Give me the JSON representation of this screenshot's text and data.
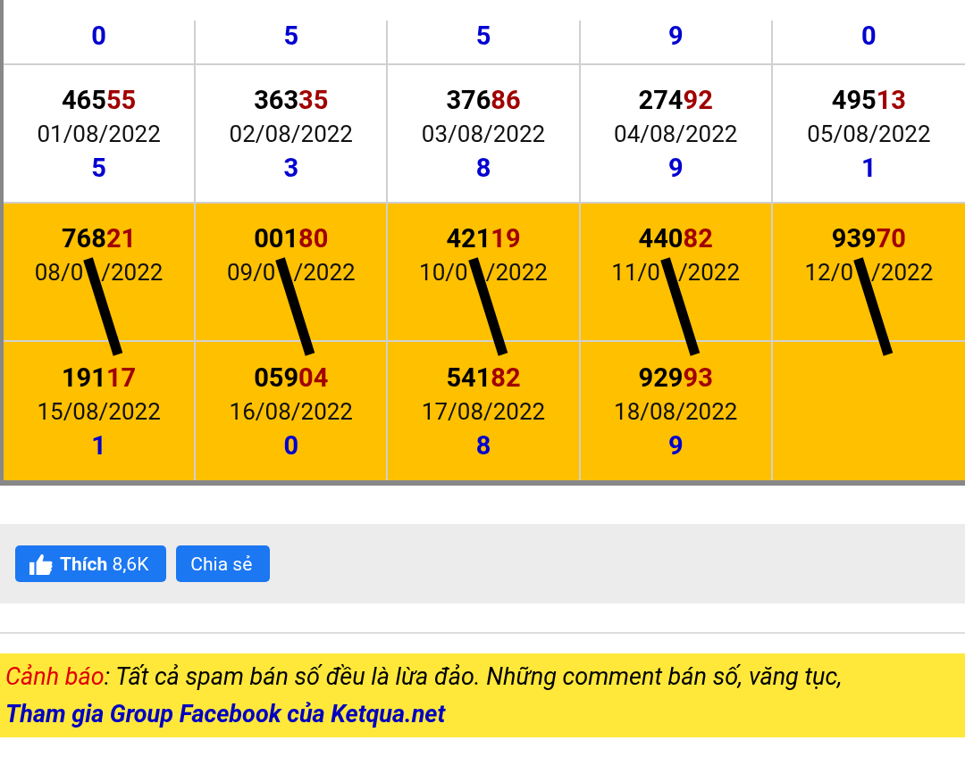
{
  "results": {
    "rows": [
      {
        "cells": [
          {
            "digit": "0"
          },
          {
            "digit": "5"
          },
          {
            "digit": "5"
          },
          {
            "digit": "9"
          },
          {
            "digit": "0"
          }
        ]
      },
      {
        "highlighted": false,
        "cells": [
          {
            "head": "465",
            "tail": "55",
            "date": "01/08/2022",
            "digit": "5",
            "crossed": false
          },
          {
            "head": "363",
            "tail": "35",
            "date": "02/08/2022",
            "digit": "3",
            "crossed": false
          },
          {
            "head": "376",
            "tail": "86",
            "date": "03/08/2022",
            "digit": "8",
            "crossed": false
          },
          {
            "head": "274",
            "tail": "92",
            "date": "04/08/2022",
            "digit": "9",
            "crossed": false
          },
          {
            "head": "495",
            "tail": "13",
            "date": "05/08/2022",
            "digit": "1",
            "crossed": false
          }
        ]
      },
      {
        "highlighted": true,
        "cells": [
          {
            "head": "768",
            "tail": "21",
            "date_start": "08/0",
            "date_end": "/2022",
            "crossed": true
          },
          {
            "head": "001",
            "tail": "80",
            "date_start": "09/0",
            "date_end": "/2022",
            "crossed": true
          },
          {
            "head": "421",
            "tail": "19",
            "date_start": "10/0",
            "date_end": "/2022",
            "crossed": true
          },
          {
            "head": "440",
            "tail": "82",
            "date_start": "11/0",
            "date_end": "/2022",
            "crossed": true
          },
          {
            "head": "939",
            "tail": "70",
            "date_start": "12/0",
            "date_end": "/2022",
            "crossed": true
          }
        ]
      },
      {
        "highlighted": true,
        "cells": [
          {
            "head": "191",
            "tail": "17",
            "date": "15/08/2022",
            "digit": "1",
            "crossed": false
          },
          {
            "head": "059",
            "tail": "04",
            "date": "16/08/2022",
            "digit": "0",
            "crossed": false
          },
          {
            "head": "541",
            "tail": "82",
            "date": "17/08/2022",
            "digit": "8",
            "crossed": false
          },
          {
            "head": "929",
            "tail": "93",
            "date": "18/08/2022",
            "digit": "9",
            "crossed": false
          }
        ]
      }
    ]
  },
  "social": {
    "like": {
      "label": "Thích",
      "count": "8,6K"
    },
    "share": {
      "label": "Chia sẻ"
    }
  },
  "notice": {
    "warning_label": "Cảnh báo",
    "warning_text": ": Tất cả spam bán số đều là lừa đảo. Những comment bán số, văng tục,",
    "link": "Tham gia Group Facebook của Ketqua.net"
  }
}
